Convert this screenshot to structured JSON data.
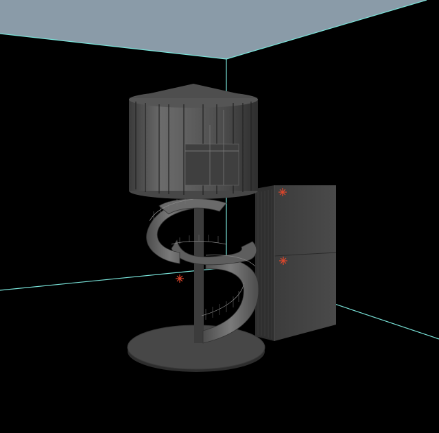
{
  "viewport": {
    "view": "perspective",
    "shading": "smooth",
    "background_color": "#000000",
    "ceiling_color": "#8a9ba8",
    "room_edge_color": "#79e3d9",
    "object_color": "#5a5a5a",
    "vertex_marker_color": "#e0472c"
  },
  "scene": {
    "objects": [
      {
        "name": "water-tank-cylinder",
        "icon": "cylinder-icon"
      },
      {
        "name": "spiral-staircase",
        "icon": "stairs-icon"
      },
      {
        "name": "base-disc",
        "icon": "disc-icon"
      },
      {
        "name": "support-block",
        "icon": "cube-icon"
      }
    ],
    "selected_pivots": 3
  }
}
